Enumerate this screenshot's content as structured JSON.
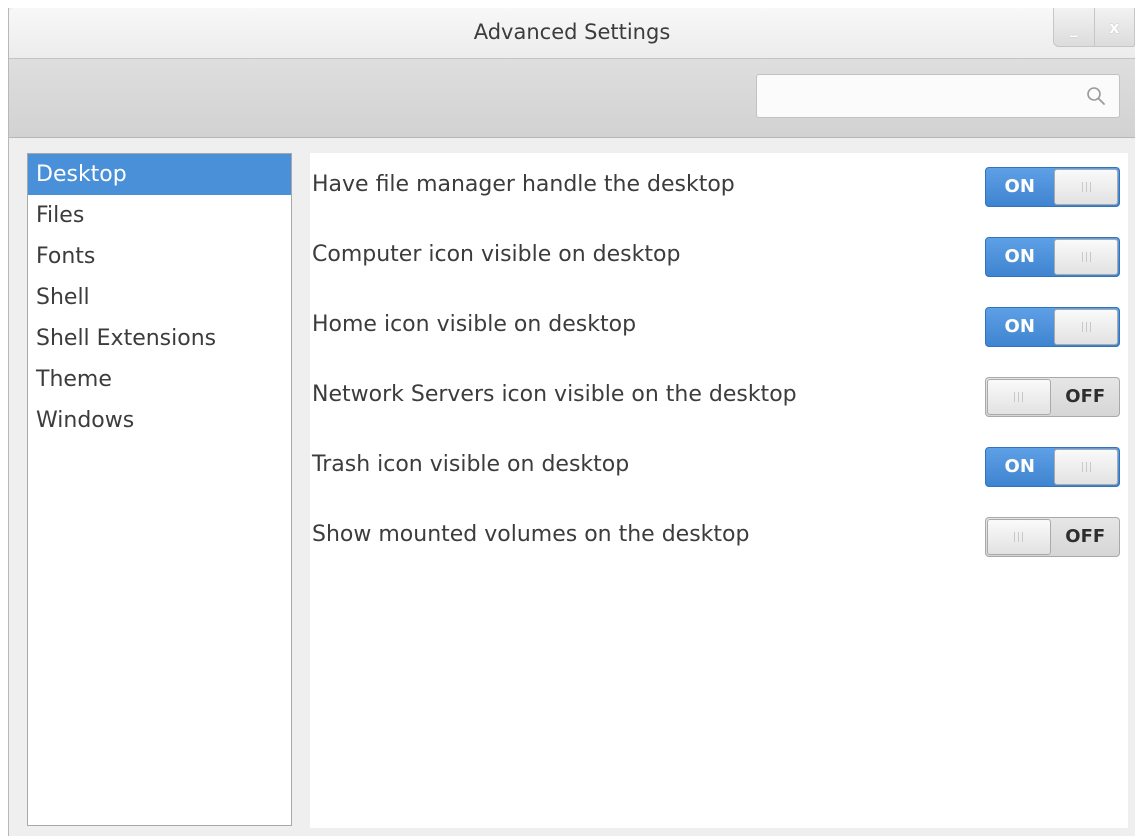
{
  "window": {
    "title": "Advanced Settings",
    "minimize_glyph": "_",
    "close_glyph": "x"
  },
  "search": {
    "value": "",
    "placeholder": "",
    "icon": "search-icon"
  },
  "sidebar": {
    "selected_index": 0,
    "items": [
      {
        "label": "Desktop"
      },
      {
        "label": "Files"
      },
      {
        "label": "Fonts"
      },
      {
        "label": "Shell"
      },
      {
        "label": "Shell Extensions"
      },
      {
        "label": "Theme"
      },
      {
        "label": "Windows"
      }
    ]
  },
  "settings": [
    {
      "label": "Have file manager handle the desktop",
      "state": "ON"
    },
    {
      "label": "Computer icon visible on desktop",
      "state": "ON"
    },
    {
      "label": "Home icon visible on desktop",
      "state": "ON"
    },
    {
      "label": "Network Servers icon visible on the desktop",
      "state": "OFF"
    },
    {
      "label": "Trash icon visible on desktop",
      "state": "ON"
    },
    {
      "label": "Show mounted volumes on the desktop",
      "state": "OFF"
    }
  ],
  "colors": {
    "accent": "#4a90d9",
    "switch_on": "#4a90d9",
    "switch_off": "#dcdcdc",
    "window_bg": "#efefef"
  }
}
